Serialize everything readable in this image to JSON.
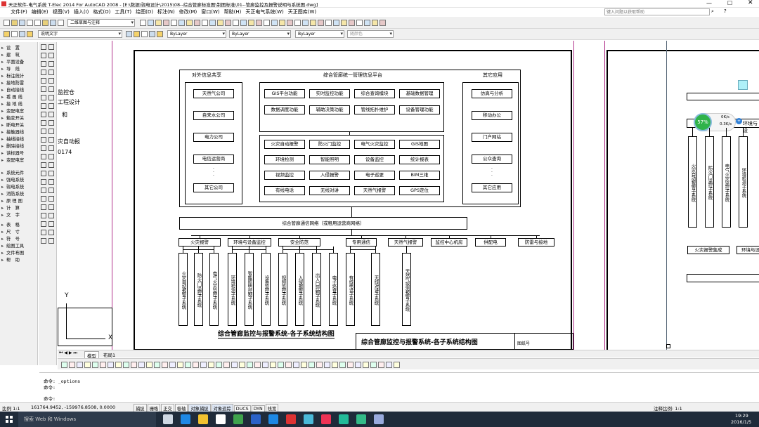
{
  "titlebar": {
    "title": "天正软件-电气系统 T-Elec 2014  For AutoCAD 2008 - [E:\\数据\\弱电设计\\2015\\08--综合管廊标准图\\制图标准\\01--管廊监控及报警说明与系统图.dwg]",
    "search_placeholder": "键入问题以获取帮助"
  },
  "menu": [
    "文件(F)",
    "编辑(E)",
    "视图(V)",
    "插入(I)",
    "格式(O)",
    "工具(T)",
    "绘图(D)",
    "标注(N)",
    "修改(M)",
    "窗口(W)",
    "帮助(H)",
    "天正电气系统(W)",
    "天正图库(W)"
  ],
  "toolbar": {
    "workspace": "二维草图与注释",
    "layer": "说明文字",
    "color": "ByLayer",
    "linetype": "ByLayer",
    "lineweight": "ByLayer",
    "plotstyle": "随颜色"
  },
  "left_panel": [
    "设　置",
    "建　筑",
    "平面设备",
    "导　线",
    "标注统计",
    "接地防雷",
    "自动接线",
    "看 画 线",
    "接 地 线",
    "变配电室",
    "箱变开关",
    "断电开关",
    "接触器线",
    "抽线接线",
    "删除接线",
    "读标器号",
    "变配电室",
    "系统元件",
    "强电系统",
    "弱电系统",
    "消防系统",
    "原 理 图",
    "计　算",
    "文　字",
    "表　格",
    "尺　寸",
    "符　号",
    "绘图工具",
    "文件布图",
    "帮　助"
  ],
  "diagram": {
    "top_title": "综合管廊统一管理信息平台",
    "left_col_title": "对外信息共享",
    "left_col": [
      "天然气公司",
      "自来水公司",
      "电力公司",
      "电信运营商",
      "其它公司"
    ],
    "right_col_title": "其它应用",
    "right_col": [
      "仿真与分析",
      "移动办公",
      "门户网站",
      "公众查询",
      "其它应用"
    ],
    "platform_top": [
      "GIS平台功能",
      "实时监控功能",
      "综合查询模块",
      "基础数据管理",
      "数据调度功能",
      "辅助决策功能",
      "管线拓扑维护",
      "设备管理功能"
    ],
    "platform_mid": [
      "火灾自动报警",
      "防火门监控",
      "电气火灾监控",
      "GIS地图",
      "环境检测",
      "智能照明",
      "设备监控",
      "统计报表",
      "视频监控",
      "入侵报警",
      "电子巡更",
      "BIM三维",
      "有线电话",
      "无线对讲",
      "天然气报警",
      "GPS定位"
    ],
    "network": "综合管廊通信网络（或租用运营商网络）",
    "categories": [
      "火灾报警",
      "环境与设备监控",
      "安全防范",
      "专用通信",
      "天然气报警",
      "监控中心机房",
      "供配电",
      "防雷与接地"
    ],
    "subsystems": [
      "火灾自动报警子系统",
      "防火门监控子系统",
      "电气火灾监控子系统",
      "环境检测子系统",
      "智能照明控制子系统",
      "设备监控子系统",
      "视频监控子系统",
      "入侵报警子系统",
      "出入口控制子系统",
      "电子巡查子系统",
      "有线电话子系统",
      "无线对讲子系统",
      "天然气探测报警子系统"
    ],
    "caption": "综合管廊监控与报警系统-各子系统结构图",
    "frame_title": "综合管廊监控与报警系统-各子系统结构图",
    "frame_label": "图纸号",
    "left_note_1": "监控仓",
    "left_note_2": "工程设计",
    "left_note_3": "和",
    "left_note_4": "灾自动报",
    "left_note_5": "0174",
    "right_subsystems": [
      "火灾自动报警子系统",
      "防火门监控子系统",
      "电气火灾监控子系统",
      "环境检测子系统"
    ],
    "right_cat_1": "火灾报警集成",
    "right_cat_2": "环境与设",
    "right_header_1": "环境与设",
    "right_cat_3": "环境与设"
  },
  "widget": {
    "percent": "57%",
    "up": "0K/s",
    "down": "0.3K/s"
  },
  "tabs": [
    "模型",
    "布局1"
  ],
  "command": {
    "line1": "命令: _options",
    "line2": "命令:",
    "line3": "命令:"
  },
  "status": {
    "scale": "比例 1:1",
    "coords": "161764.9452, -159976.8508, 0.0000",
    "toggles": [
      "捕捉",
      "栅格",
      "正交",
      "极轴",
      "对象捕捉",
      "对象追踪",
      "DUCS",
      "DYN",
      "线宽"
    ],
    "anno": "注释比例: 1:1"
  },
  "taskbar": {
    "search": "搜索 Web 和 Windows",
    "time": "19:29",
    "date": "2016/1/5"
  },
  "colors": {
    "taskbar": "#1f2b3a",
    "accent": "#0078d7"
  }
}
